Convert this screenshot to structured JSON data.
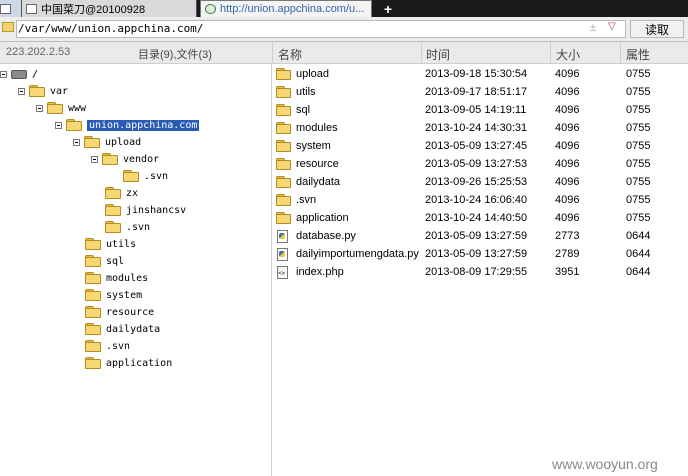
{
  "tabs": [
    {
      "label": "中国菜刀@20100928"
    },
    {
      "label": "http://union.appchina.com/u..."
    }
  ],
  "tab_add": "+",
  "address": {
    "path": "/var/www/union.appchina.com/",
    "updown": "±",
    "dropdown": "▽",
    "read_button": "读取"
  },
  "header": {
    "ip": "223.202.2.53",
    "count": "目录(9),文件(3)",
    "col_name": "名称",
    "col_time": "时间",
    "col_size": "大小",
    "col_attr": "属性"
  },
  "tree": [
    {
      "label": "/",
      "icon": "drive",
      "expanded": true
    },
    {
      "label": "var",
      "icon": "folder",
      "expanded": true
    },
    {
      "label": "www",
      "icon": "folder",
      "expanded": true
    },
    {
      "label": "union.appchina.com",
      "icon": "folder",
      "expanded": true,
      "selected": true
    },
    {
      "label": "upload",
      "icon": "folder",
      "expanded": true
    },
    {
      "label": "vendor",
      "icon": "folder",
      "expanded": true
    },
    {
      "label": ".svn",
      "icon": "folder"
    },
    {
      "label": "zx",
      "icon": "folder"
    },
    {
      "label": "jinshancsv",
      "icon": "folder"
    },
    {
      "label": ".svn",
      "icon": "folder"
    },
    {
      "label": "utils",
      "icon": "folder"
    },
    {
      "label": "sql",
      "icon": "folder"
    },
    {
      "label": "modules",
      "icon": "folder"
    },
    {
      "label": "system",
      "icon": "folder"
    },
    {
      "label": "resource",
      "icon": "folder"
    },
    {
      "label": "dailydata",
      "icon": "folder"
    },
    {
      "label": ".svn",
      "icon": "folder"
    },
    {
      "label": "application",
      "icon": "folder"
    }
  ],
  "files": [
    {
      "name": "upload",
      "time": "2013-09-18 15:30:54",
      "size": "4096",
      "attr": "0755",
      "type": "folder"
    },
    {
      "name": "utils",
      "time": "2013-09-17 18:51:17",
      "size": "4096",
      "attr": "0755",
      "type": "folder"
    },
    {
      "name": "sql",
      "time": "2013-09-05 14:19:11",
      "size": "4096",
      "attr": "0755",
      "type": "folder"
    },
    {
      "name": "modules",
      "time": "2013-10-24 14:30:31",
      "size": "4096",
      "attr": "0755",
      "type": "folder"
    },
    {
      "name": "system",
      "time": "2013-05-09 13:27:45",
      "size": "4096",
      "attr": "0755",
      "type": "folder"
    },
    {
      "name": "resource",
      "time": "2013-05-09 13:27:53",
      "size": "4096",
      "attr": "0755",
      "type": "folder"
    },
    {
      "name": "dailydata",
      "time": "2013-09-26 15:25:53",
      "size": "4096",
      "attr": "0755",
      "type": "folder"
    },
    {
      "name": ".svn",
      "time": "2013-10-24 16:06:40",
      "size": "4096",
      "attr": "0755",
      "type": "folder"
    },
    {
      "name": "application",
      "time": "2013-10-24 14:40:50",
      "size": "4096",
      "attr": "0755",
      "type": "folder"
    },
    {
      "name": "database.py",
      "time": "2013-05-09 13:27:59",
      "size": "2773",
      "attr": "0644",
      "type": "py"
    },
    {
      "name": "dailyimportumengdata.py",
      "time": "2013-05-09 13:27:59",
      "size": "2789",
      "attr": "0644",
      "type": "py"
    },
    {
      "name": "index.php",
      "time": "2013-08-09 17:29:55",
      "size": "3951",
      "attr": "0644",
      "type": "php"
    }
  ],
  "watermark": "www.wooyun.org",
  "colors": {
    "selection": "#2a5bb5",
    "folder": "#f6d774",
    "tabbar": "#1a1a1a"
  }
}
